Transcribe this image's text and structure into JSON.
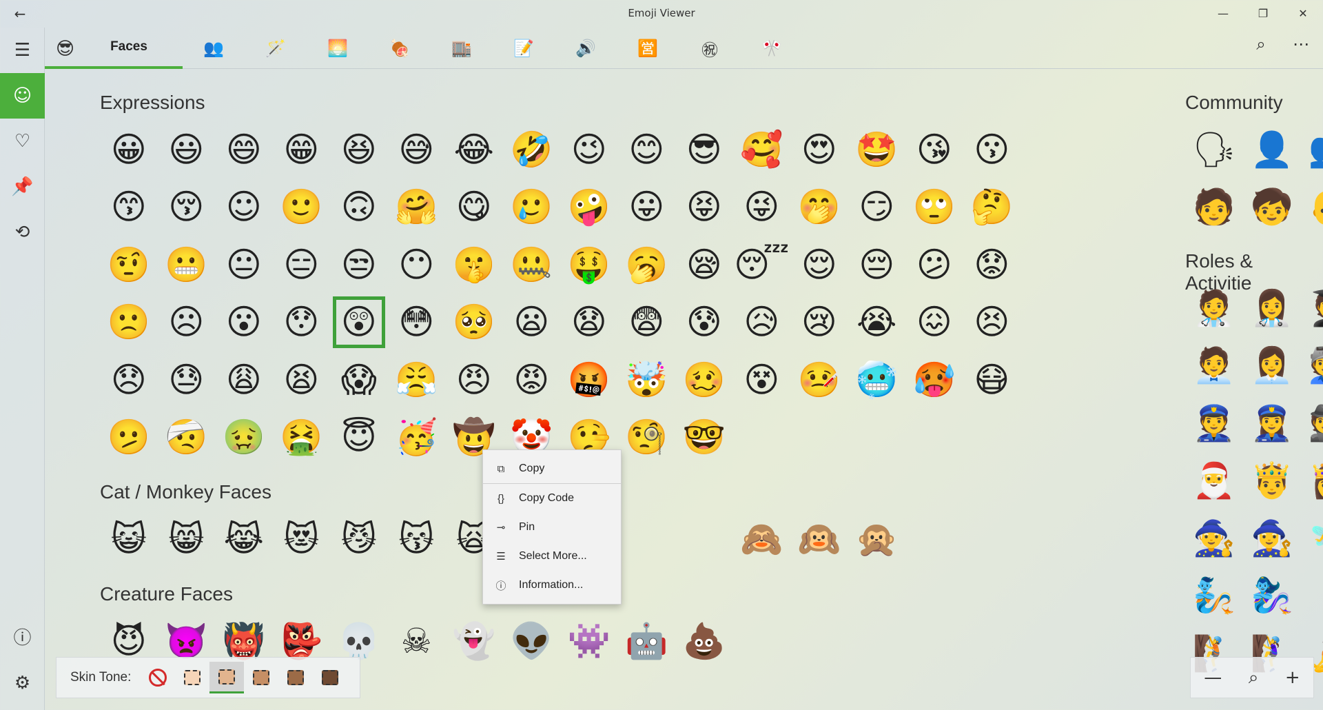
{
  "window": {
    "title": "Emoji Viewer",
    "back": "←",
    "minimize": "—",
    "maximize": "❐",
    "close": "✕"
  },
  "rail": {
    "menu": "☰",
    "emoji": "☺",
    "symbols": "♡",
    "pin": "📌",
    "history": "⟲",
    "info": "ⓘ",
    "settings": "⚙"
  },
  "categories": [
    {
      "icon": "😎",
      "label": "Faces"
    },
    {
      "icon": "👥",
      "label": ""
    },
    {
      "icon": "🪄",
      "label": ""
    },
    {
      "icon": "🌅",
      "label": ""
    },
    {
      "icon": "🍖",
      "label": ""
    },
    {
      "icon": "🏬",
      "label": ""
    },
    {
      "icon": "📝",
      "label": ""
    },
    {
      "icon": "🔊",
      "label": ""
    },
    {
      "icon": "🈺",
      "label": ""
    },
    {
      "icon": "㊗",
      "label": ""
    },
    {
      "icon": "🎌",
      "label": ""
    }
  ],
  "toolbar": {
    "search": "⌕",
    "more": "⋯"
  },
  "sections": {
    "expressions": {
      "title": "Expressions",
      "items": [
        "😀",
        "😃",
        "😄",
        "😁",
        "😆",
        "😅",
        "😂",
        "🤣",
        "😉",
        "😊",
        "😎",
        "🥰",
        "😍",
        "🤩",
        "😘",
        "😗",
        "😙",
        "😚",
        "☺",
        "🙂",
        "🙃",
        "🤗",
        "😋",
        "🥲",
        "🤪",
        "😛",
        "😝",
        "😜",
        "🤭",
        "😏",
        "🙄",
        "🤔",
        "🤨",
        "😬",
        "😐",
        "😑",
        "😒",
        "😶",
        "🤫",
        "🤐",
        "🤑",
        "🥱",
        "😪",
        "😴",
        "😌",
        "😔",
        "😕",
        "😟",
        "🙁",
        "☹",
        "😮",
        "😯",
        "😲",
        "😳",
        "🥺",
        "😦",
        "😧",
        "😨",
        "😰",
        "😥",
        "😢",
        "😭",
        "😖",
        "😣",
        "😞",
        "😓",
        "😩",
        "😫",
        "😱",
        "😤",
        "😠",
        "😡",
        "🤬",
        "🤯",
        "🥴",
        "😵",
        "🤒",
        "🥶",
        "🥵",
        "😷",
        "🫤",
        "🤕",
        "🤢",
        "🤮",
        "😇",
        "🥳",
        "🤠",
        "🤡",
        "🤥",
        "🧐",
        "🤓"
      ]
    },
    "cat_monkey": {
      "title": "Cat / Monkey Faces",
      "items": [
        "😺",
        "😸",
        "😹",
        "😻",
        "😼",
        "😽",
        "🙀",
        "",
        "",
        "",
        "",
        "🙈",
        "🙉",
        "🙊"
      ]
    },
    "creature": {
      "title": "Creature Faces",
      "items": [
        "😈",
        "👿",
        "👹",
        "👺",
        "💀",
        "☠",
        "👻",
        "👽",
        "👾",
        "🤖",
        "💩"
      ]
    },
    "community": {
      "title": "Community",
      "items": [
        "🗣",
        "👤",
        "👥",
        "🧑",
        "🧒",
        "👶"
      ]
    },
    "roles": {
      "title": "Roles & Activitie",
      "items": [
        "🧑‍⚕️",
        "👩‍⚕️",
        "🧑‍🎓",
        "🧑‍💼",
        "👩‍💼",
        "🧑‍🏭",
        "👮",
        "👮‍♀️",
        "🕵",
        "🎅",
        "🤴",
        "👸",
        "🧙",
        "🧙‍♀️",
        "🧚",
        "🧞",
        "🧞‍♀️",
        "🧜",
        "🧗",
        "🧗‍♀️",
        "🧘"
      ]
    }
  },
  "selected_index": 52,
  "context_menu": {
    "items": [
      {
        "icon": "⧉",
        "label": "Copy"
      },
      {
        "icon": "{}",
        "label": "Copy Code"
      },
      {
        "icon": "⊸",
        "label": "Pin"
      },
      {
        "icon": "☰",
        "label": "Select More..."
      },
      {
        "icon": "ⓘ",
        "label": "Information..."
      }
    ]
  },
  "skin_tone": {
    "label": "Skin Tone:",
    "tones": [
      "none",
      "#f6d5b8",
      "#e2b48e",
      "#c68f65",
      "#9c6b47",
      "#6f4a32"
    ],
    "selected": 2
  },
  "zoom": {
    "minus": "—",
    "search": "⌕",
    "plus": "+"
  },
  "accent": "#4caf3c"
}
